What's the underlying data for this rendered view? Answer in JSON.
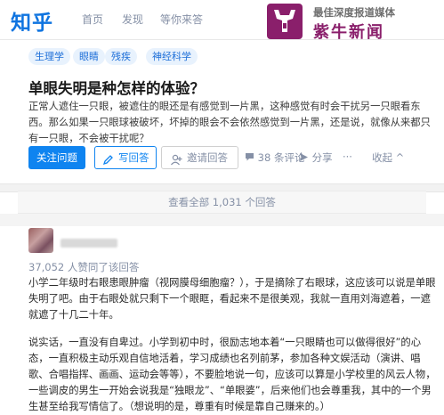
{
  "header": {
    "logo": "知乎",
    "nav": [
      "首页",
      "发现",
      "等你来答"
    ]
  },
  "watermark": {
    "tagline": "最佳深度报道媒体",
    "name": "紫牛新闻",
    "color": "#8a1f6b"
  },
  "topics": [
    "生理学",
    "眼睛",
    "残疾",
    "神经科学"
  ],
  "question": {
    "title": "单眼失明是种怎样的体验？",
    "detail": "正常人遮住一只眼，被遮住的眼还是有感觉到一片黑，这种感觉有时会干扰另一只眼看东西。那么如果一只眼球被破坏，坏掉的眼会不会依然感觉到一片黑，还是说，就像从来都只有一只眼，不会被干扰呢？"
  },
  "actions": {
    "follow": "关注问题",
    "write": "写回答",
    "invite": "邀请回答",
    "comments": "38 条评论",
    "share": "分享",
    "more": "···",
    "collapse": "收起 ^"
  },
  "view_all": "查看全部 1,031 个回答",
  "answer": {
    "votes": "37,052 人赞同了该回答",
    "paragraphs": [
      "小学二年级时右眼患眼肿瘤（视网膜母细胞瘤？），于是摘除了右眼球，这应该可以说是单眼失明了吧。由于右眼处就只剩下一个眼眶，看起来不是很美观，我就一直用刘海遮着，一遮就遮了十几二十年。",
      "说实话，一直没有自卑过。小学到初中时，很励志地本着“一只眼睛也可以做得很好”的心态，一直积极主动乐观自信地活着，学习成绩也名列前茅，参加各种文娱活动（演讲、唱歌、合唱指挥、画画、运动会等等），不要脸地说一句，应该可以算是小学校里的风云人物，一些调皮的男生一开始会说我是“独眼龙”、“单眼婆”，后来他们也会尊重我，其中的一个男生甚至给我写情信了。（想说明的是，尊重有时候是靠自己赚来的。）"
    ]
  },
  "colors": {
    "brand": "#0f74e0",
    "primary_button": "#0f84f0",
    "topic_bg": "#e8f2fd",
    "muted_text": "#8590a6"
  },
  "icons": [
    "pen-icon",
    "invite-icon",
    "comment-icon",
    "share-icon",
    "watermark-logo-icon"
  ]
}
